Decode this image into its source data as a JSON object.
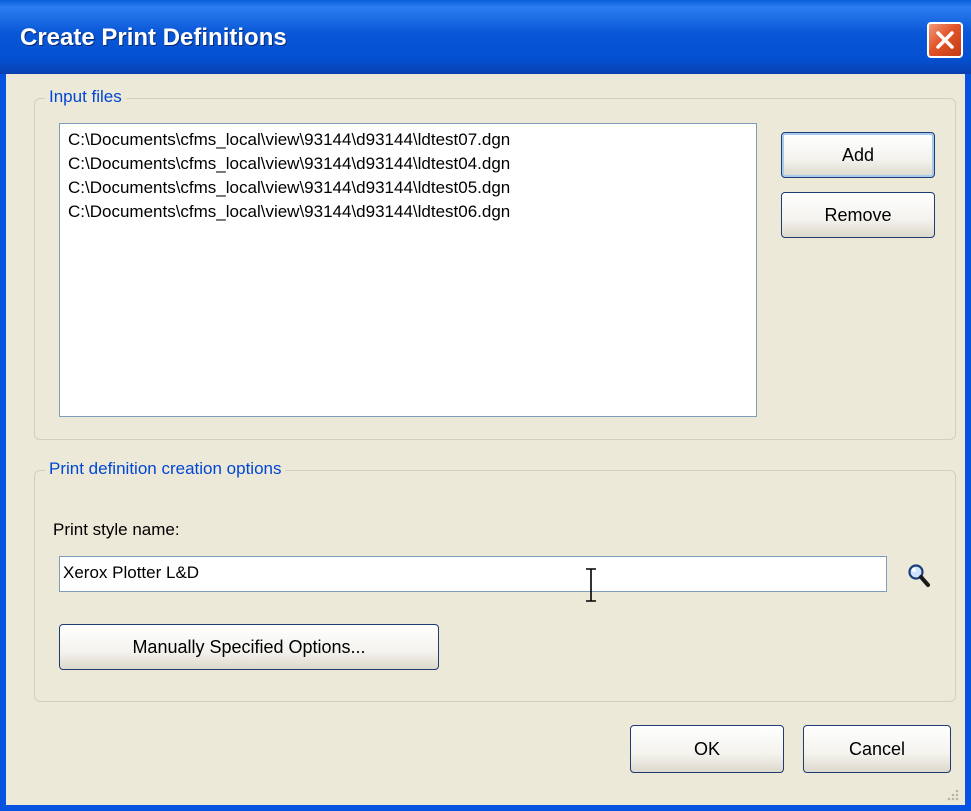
{
  "window": {
    "title": "Create Print Definitions"
  },
  "input_files": {
    "group_label": "Input files",
    "files": [
      "C:\\Documents\\cfms_local\\view\\93144\\d93144\\ldtest07.dgn",
      "C:\\Documents\\cfms_local\\view\\93144\\d93144\\ldtest04.dgn",
      "C:\\Documents\\cfms_local\\view\\93144\\d93144\\ldtest05.dgn",
      "C:\\Documents\\cfms_local\\view\\93144\\d93144\\ldtest06.dgn"
    ],
    "add_label": "Add",
    "remove_label": "Remove"
  },
  "options": {
    "group_label": "Print definition creation options",
    "print_style_label": "Print style name:",
    "print_style_value": "Xerox Plotter L&D",
    "manual_options_label": "Manually Specified Options..."
  },
  "footer": {
    "ok_label": "OK",
    "cancel_label": "Cancel"
  },
  "icons": {
    "close": "close-icon",
    "search": "magnifier-icon"
  },
  "colors": {
    "titlebar": "#0553e0",
    "dialog_bg": "#ece9d8",
    "group_label": "#0046d5",
    "close_button": "#e2542a"
  }
}
